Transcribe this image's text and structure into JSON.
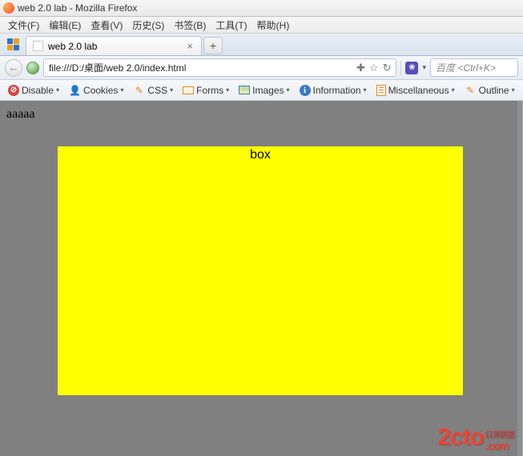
{
  "window": {
    "title": "web 2.0 lab - Mozilla Firefox"
  },
  "menubar": {
    "items": [
      {
        "label": "文件(F)",
        "key": "F"
      },
      {
        "label": "编辑(E)",
        "key": "E"
      },
      {
        "label": "查看(V)",
        "key": "V"
      },
      {
        "label": "历史(S)",
        "key": "S"
      },
      {
        "label": "书签(B)",
        "key": "B"
      },
      {
        "label": "工具(T)",
        "key": "T"
      },
      {
        "label": "帮助(H)",
        "key": "H"
      }
    ]
  },
  "tabs": {
    "active": {
      "title": "web 2.0 lab",
      "close": "×"
    },
    "newtab": "+"
  },
  "nav": {
    "back_glyph": "←",
    "url": "file:///D:/桌面/web 2.0/index.html",
    "icons": {
      "favorite_add": "✚",
      "star": "☆",
      "reload": "↻",
      "paw": "❀",
      "dropdown": "▾"
    },
    "search_placeholder": "百度 <Ctrl+K>"
  },
  "devbar": {
    "items": [
      {
        "id": "disable",
        "label": "Disable",
        "glyph": "⊘"
      },
      {
        "id": "cookies",
        "label": "Cookies",
        "glyph": "👤"
      },
      {
        "id": "css",
        "label": "CSS",
        "glyph": "✎"
      },
      {
        "id": "forms",
        "label": "Forms",
        "glyph": ""
      },
      {
        "id": "images",
        "label": "Images",
        "glyph": ""
      },
      {
        "id": "information",
        "label": "Information",
        "glyph": "i"
      },
      {
        "id": "misc",
        "label": "Miscellaneous",
        "glyph": ""
      },
      {
        "id": "outline",
        "label": "Outline",
        "glyph": "✎"
      }
    ],
    "dropdown": "▾"
  },
  "page": {
    "body_text": "aaaaa",
    "box_text": "box",
    "box_color": "#ffff00",
    "body_bg": "#808080"
  },
  "watermark": {
    "main": "2cto",
    "cn": "红黑联盟",
    "com": ".com"
  }
}
